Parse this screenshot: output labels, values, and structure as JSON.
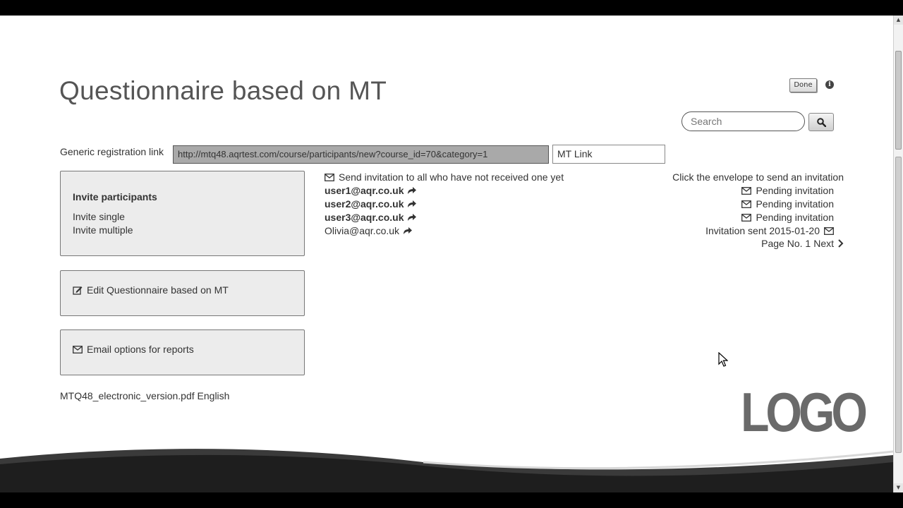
{
  "page": {
    "title": "Questionnaire based on MT",
    "done_label": "Done",
    "info_icon": "i"
  },
  "search": {
    "placeholder": "Search",
    "button_icon": "search-icon"
  },
  "registration": {
    "label": "Generic registration link",
    "url": "http://mtq48.aqrtest.com/course/participants/new?course_id=70&category=1",
    "alias": "MT Link"
  },
  "sidebar": {
    "invite": {
      "heading": "Invite participants",
      "single": "Invite single",
      "multiple": "Invite multiple"
    },
    "edit_label": "Edit Questionnaire based on MT",
    "email_label": "Email options for reports"
  },
  "attachment": "MTQ48_electronic_version.pdf English",
  "invitations": {
    "send_all": "Send invitation to all who have not received one yet",
    "hint": "Click the envelope to send an invitation",
    "participants": [
      {
        "email": "user1@aqr.co.uk",
        "status": "Pending invitation",
        "bold": true
      },
      {
        "email": "user2@aqr.co.uk",
        "status": "Pending invitation",
        "bold": true
      },
      {
        "email": "user3@aqr.co.uk",
        "status": "Pending invitation",
        "bold": true
      },
      {
        "email": "Olivia@aqr.co.uk",
        "status": "Invitation sent 2015-01-20",
        "bold": false
      }
    ],
    "pager": {
      "page_label": "Page No. 1",
      "next_label": "Next"
    }
  },
  "branding": {
    "logo_text": "LOGO"
  }
}
